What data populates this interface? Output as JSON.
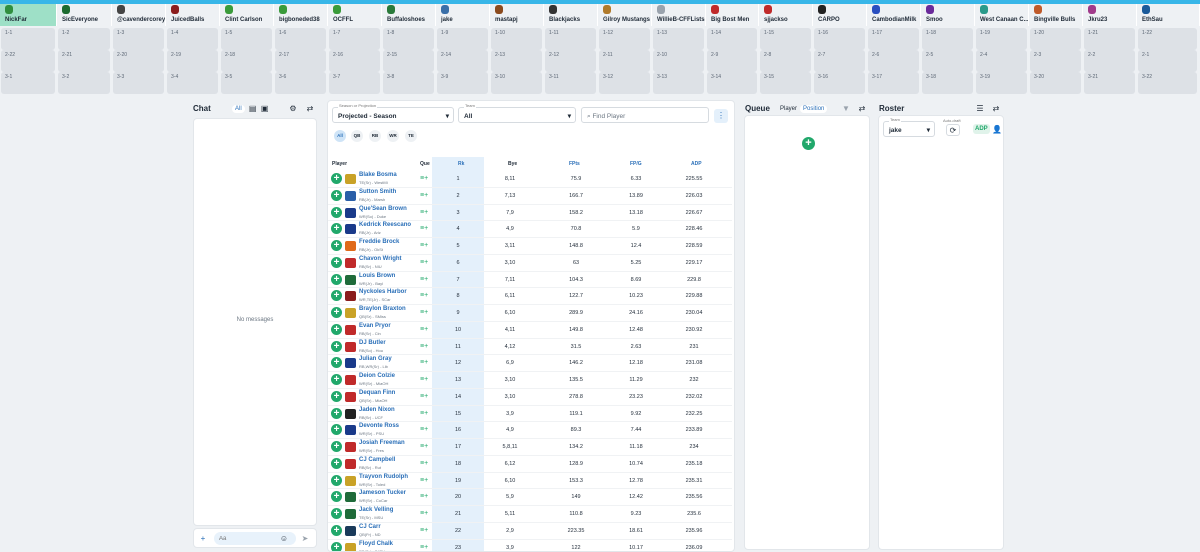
{
  "colors": {
    "accent": "#21a86b",
    "link": "#2a6fb8",
    "active_team_bg": "#9ee0c7"
  },
  "board": {
    "teams": [
      {
        "name": "NickFar",
        "logo_color": "#2f8f3f",
        "active": true
      },
      {
        "name": "SicEveryone",
        "logo_color": "#1c6b2f"
      },
      {
        "name": "@cavendercorey",
        "logo_color": "#444"
      },
      {
        "name": "JuicedBalls",
        "logo_color": "#8b1d1d"
      },
      {
        "name": "Clint Carlson",
        "logo_color": "#3a9b3a"
      },
      {
        "name": "bigboneded38",
        "logo_color": "#3a9b3a"
      },
      {
        "name": "OCFFL",
        "logo_color": "#3a9b3a"
      },
      {
        "name": "Buffaloshoes",
        "logo_color": "#2a7a3a"
      },
      {
        "name": "jake",
        "logo_color": "#3a6fa8"
      },
      {
        "name": "mastapj",
        "logo_color": "#8b4a1d"
      },
      {
        "name": "Blackjacks",
        "logo_color": "#333"
      },
      {
        "name": "Gilroy Mustangs",
        "logo_color": "#b07a2a"
      },
      {
        "name": "WillieB-CFFLists",
        "logo_color": "#9aa3ad"
      },
      {
        "name": "Big Bost Men",
        "logo_color": "#c02a2a"
      },
      {
        "name": "sjjackso",
        "logo_color": "#c02a2a"
      },
      {
        "name": "CARPO",
        "logo_color": "#222"
      },
      {
        "name": "CambodianMilk",
        "logo_color": "#2a4fc0"
      },
      {
        "name": "Smoo",
        "logo_color": "#6a2a9a"
      },
      {
        "name": "West Canaan C...",
        "logo_color": "#2a9a8a"
      },
      {
        "name": "Bingville Bulls",
        "logo_color": "#c05a2a"
      },
      {
        "name": "Jkru23",
        "logo_color": "#a03a8a"
      },
      {
        "name": "EthSau",
        "logo_color": "#1a5a9a"
      }
    ],
    "round1": [
      "1-1",
      "1-2",
      "1-3",
      "1-4",
      "1-5",
      "1-6",
      "1-7",
      "1-8",
      "1-9",
      "1-10",
      "1-11",
      "1-12",
      "1-13",
      "1-14",
      "1-15",
      "1-16",
      "1-17",
      "1-18",
      "1-19",
      "1-20",
      "1-21",
      "1-22"
    ],
    "round2": [
      "2-22",
      "2-21",
      "2-20",
      "2-19",
      "2-18",
      "2-17",
      "2-16",
      "2-15",
      "2-14",
      "2-13",
      "2-12",
      "2-11",
      "2-10",
      "2-9",
      "2-8",
      "2-7",
      "2-6",
      "2-5",
      "2-4",
      "2-3",
      "2-2",
      "2-1"
    ],
    "round3": [
      "3-1",
      "3-2",
      "3-3",
      "3-4",
      "3-5",
      "3-6",
      "3-7",
      "3-8",
      "3-9",
      "3-10",
      "3-11",
      "3-12",
      "3-13",
      "3-14",
      "3-15",
      "3-16",
      "3-17",
      "3-18",
      "3-19",
      "3-20",
      "3-21",
      "3-22"
    ]
  },
  "chat": {
    "title": "Chat",
    "filter_all": "All",
    "empty": "No messages",
    "input_placeholder": "Aa"
  },
  "players": {
    "season_label": "Season or Projection",
    "season_value": "Projected - Season",
    "team_label": "Team",
    "team_value": "All",
    "search_placeholder": "Find Player",
    "positions": [
      "All",
      "QB",
      "RB",
      "WR",
      "TE"
    ],
    "columns": {
      "player": "Player",
      "que": "Que",
      "rk": "Rk",
      "bye": "Bye",
      "fpts": "FPts",
      "fpg": "FP/G",
      "adp": "ADP"
    },
    "rows": [
      {
        "name": "Blake Bosma",
        "sub": "TE(Sr) - WestMi",
        "rk": "1",
        "bye": "8,11",
        "fpts": "75.9",
        "fpg": "6.33",
        "adp": "225.55",
        "logo": "#c9a227"
      },
      {
        "name": "Sutton Smith",
        "sub": "RB(Jr) - Marsh",
        "rk": "2",
        "bye": "7,13",
        "fpts": "166.7",
        "fpg": "13.89",
        "adp": "226.03",
        "logo": "#2a5fa8"
      },
      {
        "name": "Que'Sean Brown",
        "sub": "WR(So) - Duke",
        "rk": "3",
        "bye": "7,9",
        "fpts": "158.2",
        "fpg": "13.18",
        "adp": "226.67",
        "logo": "#1a3a8a"
      },
      {
        "name": "Kedrick Reescano",
        "sub": "RB(Jr) - Ariz",
        "rk": "4",
        "bye": "4,9",
        "fpts": "70.8",
        "fpg": "5.9",
        "adp": "228.46",
        "logo": "#1a3a8a"
      },
      {
        "name": "Freddie Brock",
        "sub": "RB(Jr) - OkSt",
        "rk": "5",
        "bye": "3,11",
        "fpts": "148.8",
        "fpg": "12.4",
        "adp": "228.59",
        "logo": "#e06a1a"
      },
      {
        "name": "Chavon Wright",
        "sub": "RB(Sr) - NIU",
        "rk": "6",
        "bye": "3,10",
        "fpts": "63",
        "fpg": "5.25",
        "adp": "229.17",
        "logo": "#c02a2a"
      },
      {
        "name": "Louis Brown",
        "sub": "WR(Jr) - Bayl",
        "rk": "7",
        "bye": "7,11",
        "fpts": "104.3",
        "fpg": "8.69",
        "adp": "229.8",
        "logo": "#1f6b3a"
      },
      {
        "name": "Nyckoles Harbor",
        "sub": "WR,TE(Jr) - SCar",
        "rk": "8",
        "bye": "6,11",
        "fpts": "122.7",
        "fpg": "10.23",
        "adp": "229.88",
        "logo": "#8b1d1d"
      },
      {
        "name": "Braylon Braxton",
        "sub": "QB(Sr) - SMiss",
        "rk": "9",
        "bye": "6,10",
        "fpts": "289.9",
        "fpg": "24.16",
        "adp": "230.04",
        "logo": "#c9a227"
      },
      {
        "name": "Evan Pryor",
        "sub": "RB(Sr) - Cin",
        "rk": "10",
        "bye": "4,11",
        "fpts": "149.8",
        "fpg": "12.48",
        "adp": "230.92",
        "logo": "#c02a2a"
      },
      {
        "name": "DJ Butler",
        "sub": "RB(So) - Hou",
        "rk": "11",
        "bye": "4,12",
        "fpts": "31.5",
        "fpg": "2.63",
        "adp": "231",
        "logo": "#c02a2a"
      },
      {
        "name": "Julian Gray",
        "sub": "RB,WR(Sr) - Lib",
        "rk": "12",
        "bye": "6,9",
        "fpts": "146.2",
        "fpg": "12.18",
        "adp": "231.08",
        "logo": "#1a3a8a"
      },
      {
        "name": "Deion Colzie",
        "sub": "WR(Sr) - MiaOH",
        "rk": "13",
        "bye": "3,10",
        "fpts": "135.5",
        "fpg": "11.29",
        "adp": "232",
        "logo": "#c02a2a"
      },
      {
        "name": "Dequan Finn",
        "sub": "QB(Sr) - MiaOH",
        "rk": "14",
        "bye": "3,10",
        "fpts": "278.8",
        "fpg": "23.23",
        "adp": "232.02",
        "logo": "#c02a2a"
      },
      {
        "name": "Jaden Nixon",
        "sub": "RB(Sr) - UCF",
        "rk": "15",
        "bye": "3,9",
        "fpts": "119.1",
        "fpg": "9.92",
        "adp": "232.25",
        "logo": "#222"
      },
      {
        "name": "Devonte Ross",
        "sub": "WR(Sr) - PSU",
        "rk": "16",
        "bye": "4,9",
        "fpts": "89.3",
        "fpg": "7.44",
        "adp": "233.89",
        "logo": "#1a3a8a"
      },
      {
        "name": "Josiah Freeman",
        "sub": "WR(Sr) - Fres",
        "rk": "17",
        "bye": "5,8,11",
        "fpts": "134.2",
        "fpg": "11.18",
        "adp": "234",
        "logo": "#c02a2a"
      },
      {
        "name": "CJ Campbell",
        "sub": "RB(Sr) - Rut",
        "rk": "18",
        "bye": "6,12",
        "fpts": "128.9",
        "fpg": "10.74",
        "adp": "235.18",
        "logo": "#c02a2a"
      },
      {
        "name": "Trayvon Rudolph",
        "sub": "WR(Sr) - Toled",
        "rk": "19",
        "bye": "6,10",
        "fpts": "153.3",
        "fpg": "12.78",
        "adp": "235.31",
        "logo": "#c9a227"
      },
      {
        "name": "Jameson Tucker",
        "sub": "WR(Sr) - CoCar",
        "rk": "20",
        "bye": "5,9",
        "fpts": "149",
        "fpg": "12.42",
        "adp": "235.56",
        "logo": "#1f6b3a"
      },
      {
        "name": "Jack Velling",
        "sub": "TE(Sr) - MSU",
        "rk": "21",
        "bye": "5,11",
        "fpts": "110.8",
        "fpg": "9.23",
        "adp": "235.6",
        "logo": "#1f6b3a"
      },
      {
        "name": "CJ Carr",
        "sub": "QB(Fr) - ND",
        "rk": "22",
        "bye": "2,9",
        "fpts": "223.35",
        "fpg": "18.61",
        "adp": "235.96",
        "logo": "#1a3a5a"
      },
      {
        "name": "Floyd Chalk",
        "sub": "RB(Sr) - SJSU",
        "rk": "23",
        "bye": "3,9",
        "fpts": "122",
        "fpg": "10.17",
        "adp": "236.09",
        "logo": "#c9a227"
      }
    ]
  },
  "queue": {
    "title": "Queue",
    "tab_player": "Player",
    "tab_position": "Position"
  },
  "roster": {
    "title": "Roster",
    "team_label": "Team",
    "team_value": "jake",
    "autodraft_label": "Auto-draft",
    "adp_label": "ADP"
  }
}
